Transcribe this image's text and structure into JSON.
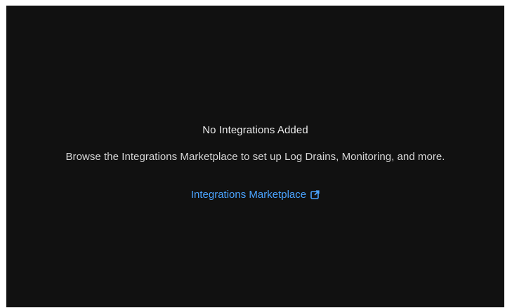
{
  "empty_state": {
    "title": "No Integrations Added",
    "description": "Browse the Integrations Marketplace to set up Log Drains, Monitoring, and more.",
    "link_label": "Integrations Marketplace",
    "link_icon": "external-link-icon"
  },
  "colors": {
    "background": "#111111",
    "link": "#4aa3ff",
    "title_text": "#ededed",
    "body_text": "#d6d6d6"
  }
}
